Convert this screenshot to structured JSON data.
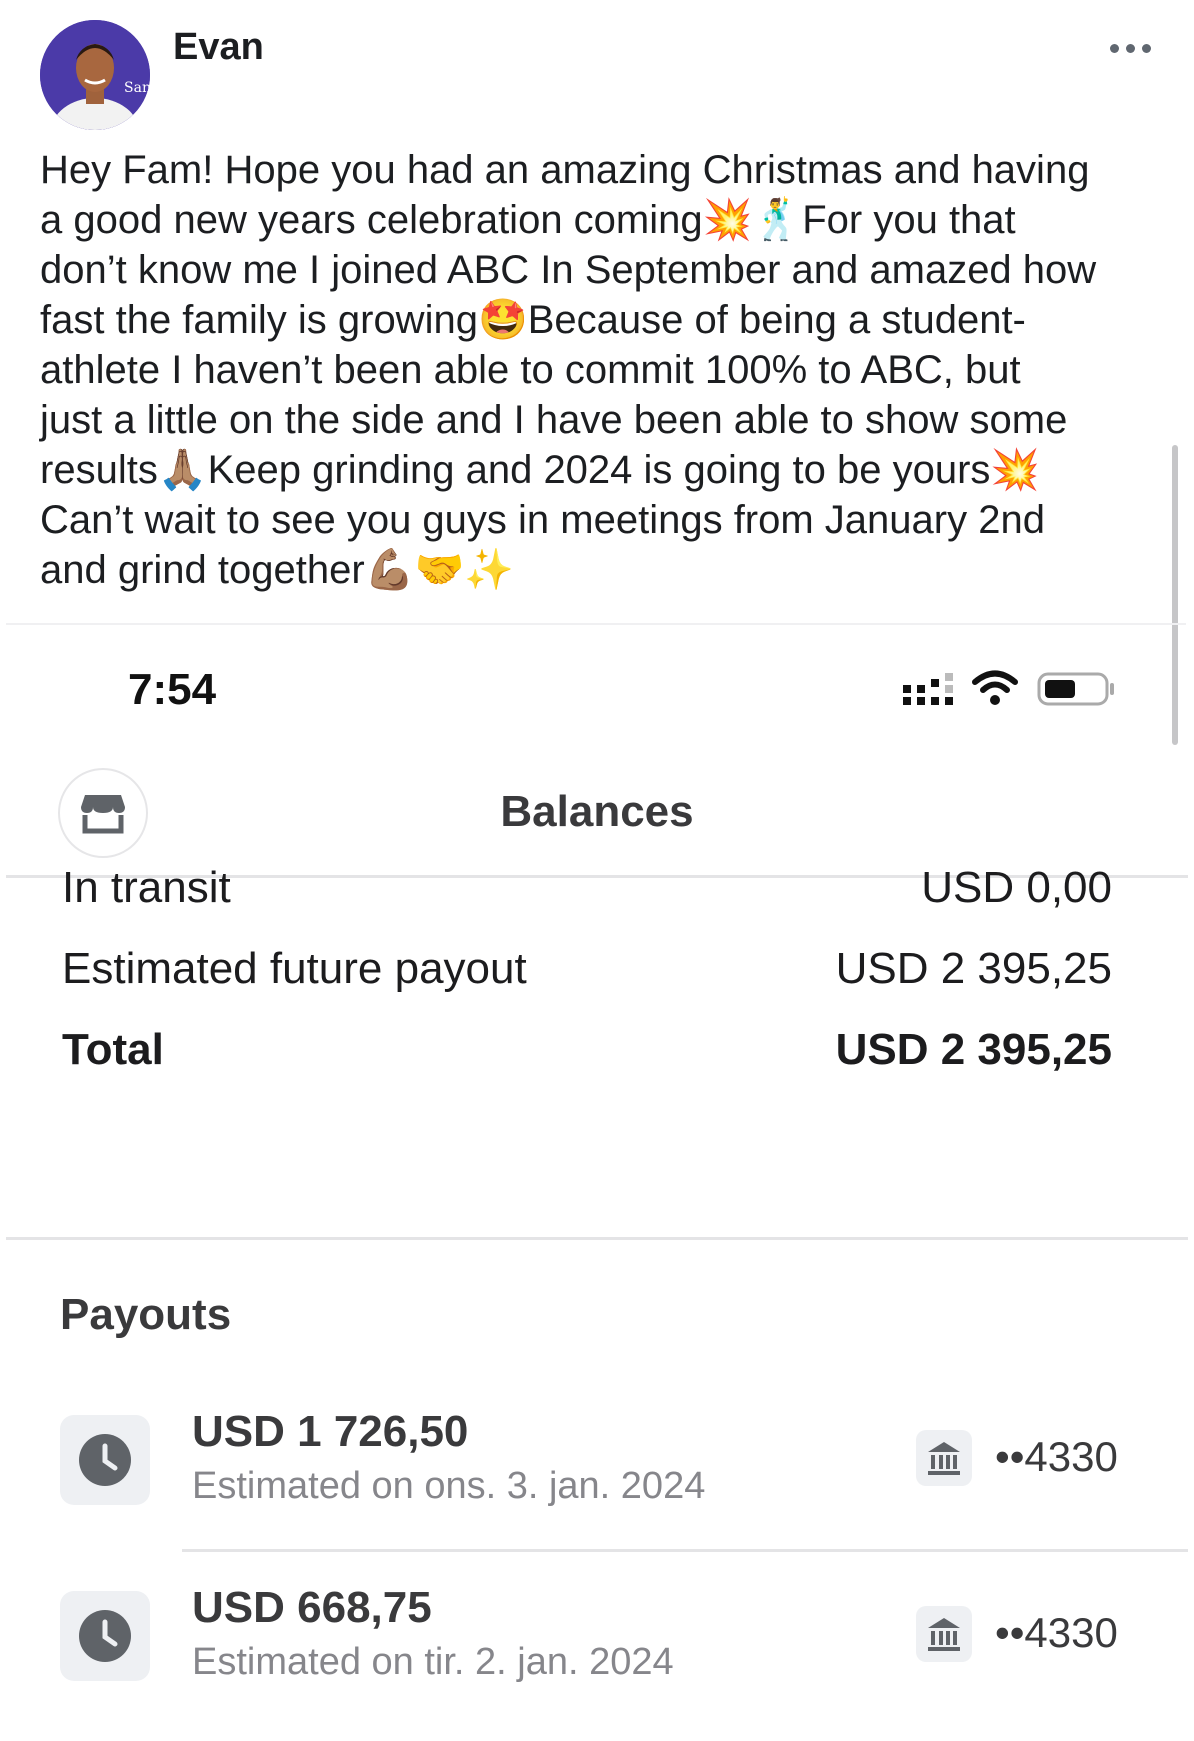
{
  "post": {
    "author": "Evan",
    "avatar_text": "San",
    "text": "Hey Fam! Hope you had an amazing Christmas and having\na good new years celebration coming💥🕺For you that\ndon’t know me I joined ABC In September and amazed how\nfast the family is growing🤩Because of being a student-\nathlete I haven’t been able to commit 100% to ABC, but\njust a little on the side and I have been able to show some\nresults🙏🏽Keep grinding and 2024 is going to be yours💥\nCan’t wait to see you guys in meetings from January 2nd\nand grind together💪🏽🤝✨"
  },
  "screenshot": {
    "status_time": "7:54",
    "title": "Balances",
    "balances": [
      {
        "label": "In transit",
        "value": "USD 0,00"
      },
      {
        "label": "Estimated future payout",
        "value": "USD 2 395,25"
      },
      {
        "label": "Total",
        "value": "USD 2 395,25"
      }
    ],
    "payouts_heading": "Payouts",
    "payouts": [
      {
        "amount": "USD 1 726,50",
        "date": "Estimated on ons. 3. jan. 2024",
        "account": "••4330"
      },
      {
        "amount": "USD 668,75",
        "date": "Estimated on tir. 2. jan. 2024",
        "account": "••4330"
      }
    ]
  },
  "colors": {
    "accent_avatar": "#4b3aa8",
    "icon_gray": "#5f6368"
  },
  "icons": [
    "more-icon",
    "store-icon",
    "clock-icon",
    "bank-icon",
    "signal-icon",
    "wifi-icon",
    "battery-icon"
  ]
}
